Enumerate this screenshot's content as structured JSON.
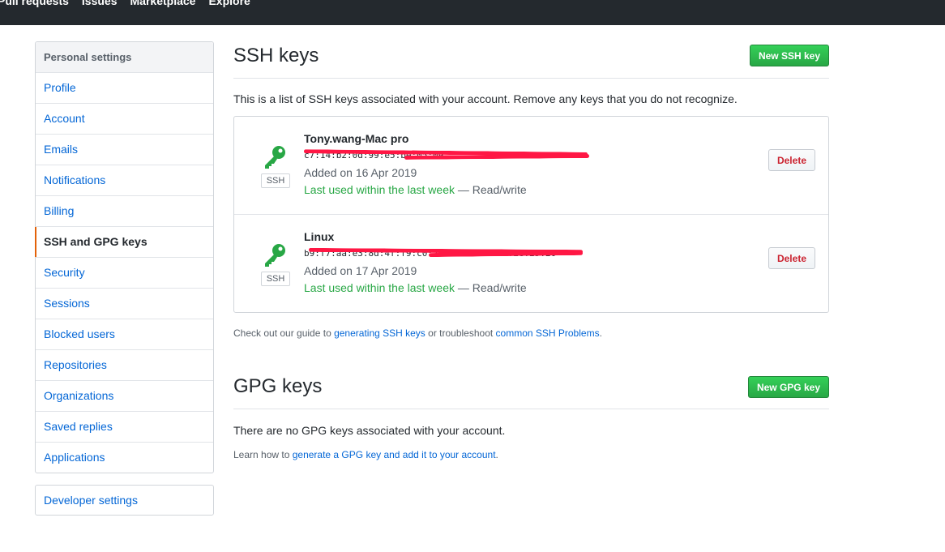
{
  "topnav": [
    "Pull requests",
    "Issues",
    "Marketplace",
    "Explore"
  ],
  "sidebar": {
    "heading": "Personal settings",
    "items": [
      {
        "label": "Profile",
        "selected": false
      },
      {
        "label": "Account",
        "selected": false
      },
      {
        "label": "Emails",
        "selected": false
      },
      {
        "label": "Notifications",
        "selected": false
      },
      {
        "label": "Billing",
        "selected": false
      },
      {
        "label": "SSH and GPG keys",
        "selected": true
      },
      {
        "label": "Security",
        "selected": false
      },
      {
        "label": "Sessions",
        "selected": false
      },
      {
        "label": "Blocked users",
        "selected": false
      },
      {
        "label": "Repositories",
        "selected": false
      },
      {
        "label": "Organizations",
        "selected": false
      },
      {
        "label": "Saved replies",
        "selected": false
      },
      {
        "label": "Applications",
        "selected": false
      }
    ],
    "developer": "Developer settings"
  },
  "ssh": {
    "title": "SSH keys",
    "new_button": "New SSH key",
    "intro": "This is a list of SSH keys associated with your account. Remove any keys that you do not recognize.",
    "keys": [
      {
        "title": "Tony.wang-Mac pro",
        "fingerprint": "c7:14:b2:0d:99:e5:be:05:09",
        "added": "Added on 16 Apr 2019",
        "last_used": "Last used within the last week",
        "access": "— Read/write",
        "type_label": "SSH",
        "delete_label": "Delete",
        "icon": "key-icon"
      },
      {
        "title": "Linux",
        "fingerprint": "b9:f7:aa:e3:8d:4f:f9:c0:2d:8a:19:50:bd:2e:25:20",
        "added": "Added on 17 Apr 2019",
        "last_used": "Last used within the last week",
        "access": "— Read/write",
        "type_label": "SSH",
        "delete_label": "Delete",
        "icon": "key-icon"
      }
    ],
    "guide": {
      "prefix": "Check out our guide to ",
      "link1": "generating SSH keys",
      "middle": " or troubleshoot ",
      "link2": "common SSH Problems",
      "suffix": "."
    }
  },
  "gpg": {
    "title": "GPG keys",
    "new_button": "New GPG key",
    "empty": "There are no GPG keys associated with your account.",
    "learn": {
      "prefix": "Learn how to ",
      "link": "generate a GPG key and add it to your account",
      "suffix": "."
    }
  },
  "colors": {
    "accent_green": "#28a745",
    "link": "#0366d6",
    "danger": "#cb2431",
    "selected_marker": "#e36209"
  }
}
